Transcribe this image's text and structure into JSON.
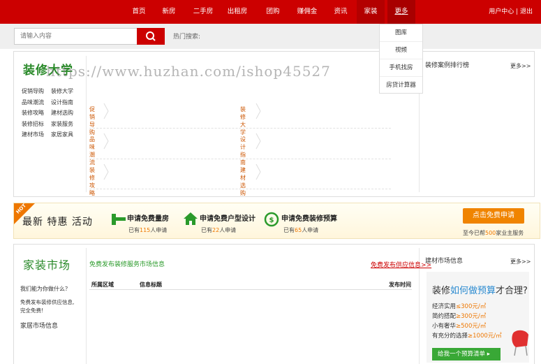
{
  "nav": {
    "items": [
      "首页",
      "新房",
      "二手房",
      "出租房",
      "团购",
      "赚佣金",
      "资讯",
      "家装",
      "更多"
    ],
    "user_links": "用户中心 | 退出"
  },
  "search": {
    "placeholder": "请输入内容",
    "hot_label": "热门搜索:"
  },
  "dropdown": {
    "items": [
      "图库",
      "视频",
      "手机找房",
      "房贷计算器"
    ]
  },
  "watermark": "https://www.huzhan.com/ishop45527",
  "decoration": {
    "title": "装修大学",
    "links_left": [
      "促销导购",
      "品味潮流",
      "装修攻略",
      "装修招标",
      "建材市场"
    ],
    "links_right": [
      "装修大学",
      "设计指南",
      "建材选购",
      "家装服务",
      "家居家具"
    ],
    "categories": {
      "r1c1": "促销导购",
      "r1c2": "装修大学",
      "r2c1": "品味潮流",
      "r2c2": "设计指南",
      "r3c1": "装修攻略",
      "r3c2": "建材选购"
    },
    "ranking_title": "装修案例排行榜",
    "more": "更多>>"
  },
  "banner": {
    "hot": "HOT",
    "slogan": "最新  特惠  活动",
    "items": [
      {
        "title": "申请免费量房",
        "prefix": "已有",
        "count": "115",
        "suffix": "人申请"
      },
      {
        "title": "申请免费户型设计",
        "prefix": "已有",
        "count": "22",
        "suffix": "人申请"
      },
      {
        "title": "申请免费装修预算",
        "prefix": "已有",
        "count": "65",
        "suffix": "人申请"
      }
    ],
    "cta": "点击免费申请",
    "served_prefix": "至今已帮",
    "served_count": "500",
    "served_suffix": "家业主服务"
  },
  "market": {
    "title": "家装市场",
    "question": "我们能为你做什么？",
    "desc_line1": "免费发布装修供应信息,",
    "desc_line2": "完全免费!",
    "home_info": "家居市场信息",
    "free_publish": "免费发布装修服务市场信息",
    "supply_link": "免费发布供应信息>>",
    "table_headers": {
      "area": "所属区域",
      "title": "信息标题",
      "time": "发布时间"
    },
    "side_title": "建材市场信息",
    "more": "更多>>"
  },
  "ad": {
    "title_prefix": "装修",
    "title_em": "如何做预算",
    "title_suffix": "才合理?",
    "lines": [
      {
        "label": "经济实用",
        "price": "≤300元/㎡"
      },
      {
        "label": "简约搭配",
        "price": "≥300元/㎡"
      },
      {
        "label": "小有奢华",
        "price": "≥500元/㎡"
      },
      {
        "label": "有充分的选择",
        "price": "≥1000元/㎡"
      }
    ],
    "button": "给我一个预算清单 ▸"
  },
  "colors": {
    "brand_red": "#cc0000",
    "green": "#2a8a2a",
    "orange": "#ee7700"
  }
}
